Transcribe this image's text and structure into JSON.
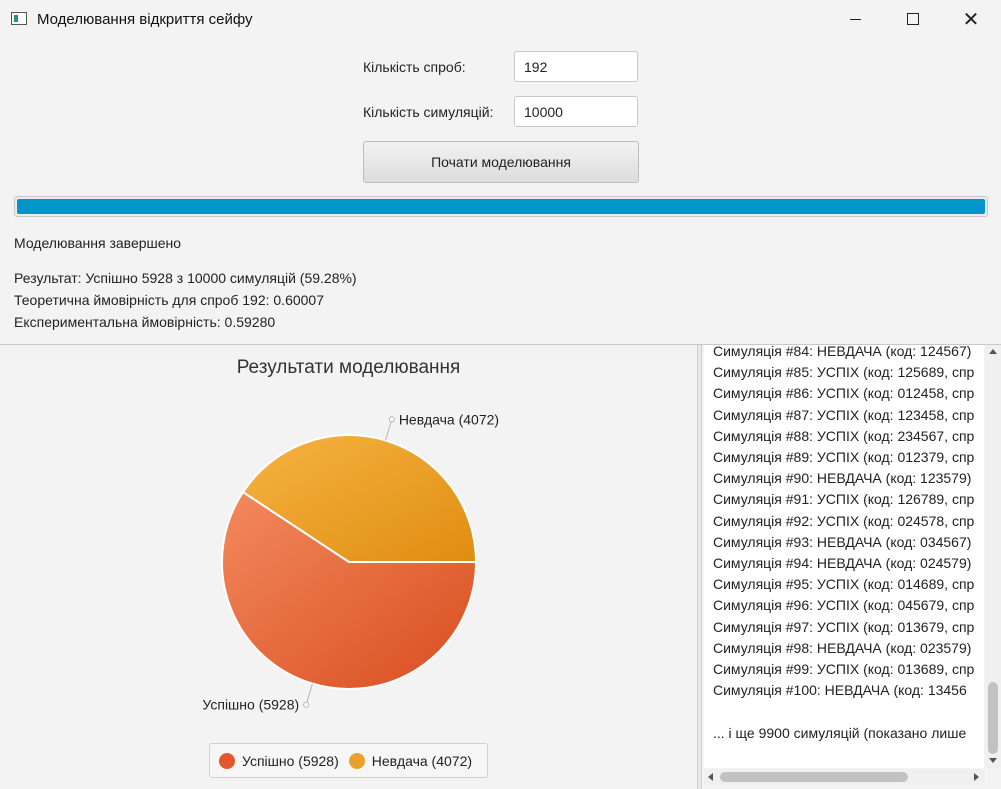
{
  "window": {
    "title": "Моделювання відкриття сейфу",
    "icon": "app-window-icon"
  },
  "form": {
    "attempts_label": "Кількість спроб:",
    "attempts_value": "192",
    "simulations_label": "Кількість симуляцій:",
    "simulations_value": "10000",
    "start_button": "Почати моделювання"
  },
  "progress": {
    "fraction": 1.0,
    "color": "#0096c9"
  },
  "status": "Моделювання завершено",
  "results": {
    "line1": "Результат: Успішно 5928 з 10000 симуляцій (59.28%)",
    "line2": "Теоретична ймовірність для спроб 192: 0.60007",
    "line3": "Експериментальна ймовірність: 0.59280"
  },
  "chart_data": {
    "type": "pie",
    "title": "Результати моделювання",
    "slices": [
      {
        "label": "Успішно (5928)",
        "value": 5928,
        "color": "#e4572e"
      },
      {
        "label": "Невдача (4072)",
        "value": 4072,
        "color": "#eaa02a"
      }
    ],
    "legend_position": "bottom"
  },
  "log": {
    "lines": [
      "Симуляція #84: НЕВДАЧА (код: 124567)",
      "Симуляція #85: УСПІХ (код: 125689, спр",
      "Симуляція #86: УСПІХ (код: 012458, спр",
      "Симуляція #87: УСПІХ (код: 123458, спр",
      "Симуляція #88: УСПІХ (код: 234567, спр",
      "Симуляція #89: УСПІХ (код: 012379, спр",
      "Симуляція #90: НЕВДАЧА (код: 123579)",
      "Симуляція #91: УСПІХ (код: 126789, спр",
      "Симуляція #92: УСПІХ (код: 024578, спр",
      "Симуляція #93: НЕВДАЧА (код: 034567)",
      "Симуляція #94: НЕВДАЧА (код: 024579)",
      "Симуляція #95: УСПІХ (код: 014689, спр",
      "Симуляція #96: УСПІХ (код: 045679, спр",
      "Симуляція #97: УСПІХ (код: 013679, спр",
      "Симуляція #98: НЕВДАЧА (код: 023579)",
      "Симуляція #99: УСПІХ (код: 013689, спр",
      "Симуляція #100: НЕВДАЧА (код: 13456",
      "",
      "... і ще 9900 симуляцій (показано лише"
    ]
  }
}
